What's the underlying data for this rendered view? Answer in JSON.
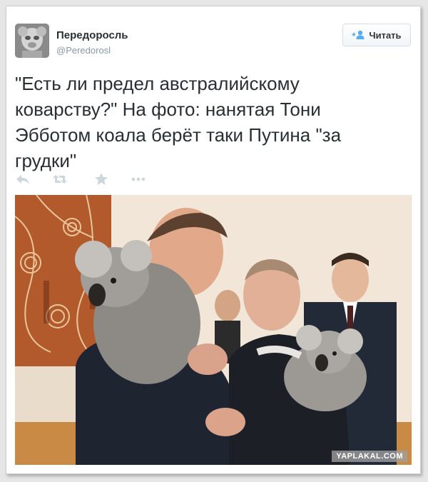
{
  "user": {
    "name": "Передоросль",
    "handle": "@Peredorosl"
  },
  "follow_button": {
    "label": "Читать"
  },
  "tweet": {
    "lines": [
      "\"Есть ли предел австралийскому",
      "коварству?\" На фото: нанятая Тони",
      "Эбботом коала берёт таки Путина \"за",
      "грудки\""
    ]
  },
  "actions": {
    "icons": [
      "reply-icon",
      "retweet-icon",
      "favorite-icon",
      "more-icon"
    ]
  },
  "photo": {
    "watermark": "YAPLAKAL.COM"
  },
  "colors": {
    "text": "#292f33",
    "muted": "#8899a6",
    "follow_accent": "#55acee",
    "action_icon": "#ccd6dd"
  }
}
